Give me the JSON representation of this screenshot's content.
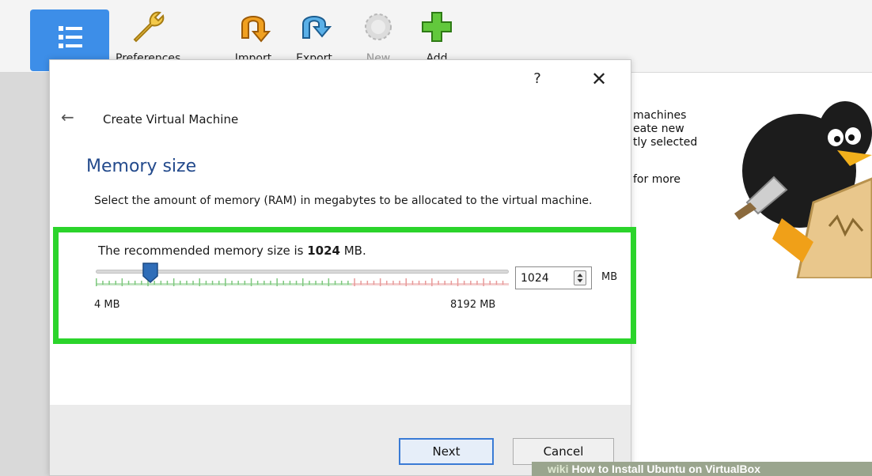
{
  "toolbar": {
    "preferences_label": "Preferences",
    "import_label": "Import",
    "export_label": "Export",
    "new_label": "New",
    "add_label": "Add"
  },
  "welcome_snippet": {
    "line1": "machines",
    "line2": "eate new",
    "line3": "tly selected",
    "line4": "for more"
  },
  "dialog": {
    "help_label": "?",
    "close_label": "✕",
    "back_label": "←",
    "title": "Create Virtual Machine",
    "section_heading": "Memory size",
    "description": "Select the amount of memory (RAM) in megabytes to be allocated to the virtual machine.",
    "recommended_prefix": "The recommended memory size is ",
    "recommended_value": "1024",
    "recommended_suffix": " MB.",
    "memory": {
      "value_mb": 1024,
      "min_mb": 4,
      "max_mb": 8192,
      "input_value": "1024",
      "unit": "MB",
      "min_label": "4 MB",
      "max_label": "8192 MB"
    },
    "buttons": {
      "next": "Next",
      "cancel": "Cancel"
    }
  },
  "watermark": {
    "brand": "wiki",
    "text": "How to Install Ubuntu on VirtualBox"
  },
  "colors": {
    "highlight_border": "#2bd42b",
    "heading_blue": "#234a8c",
    "tools_blue": "#3d8ee8",
    "ticks_green": "#7ec87e",
    "ticks_red": "#e89a9a"
  }
}
